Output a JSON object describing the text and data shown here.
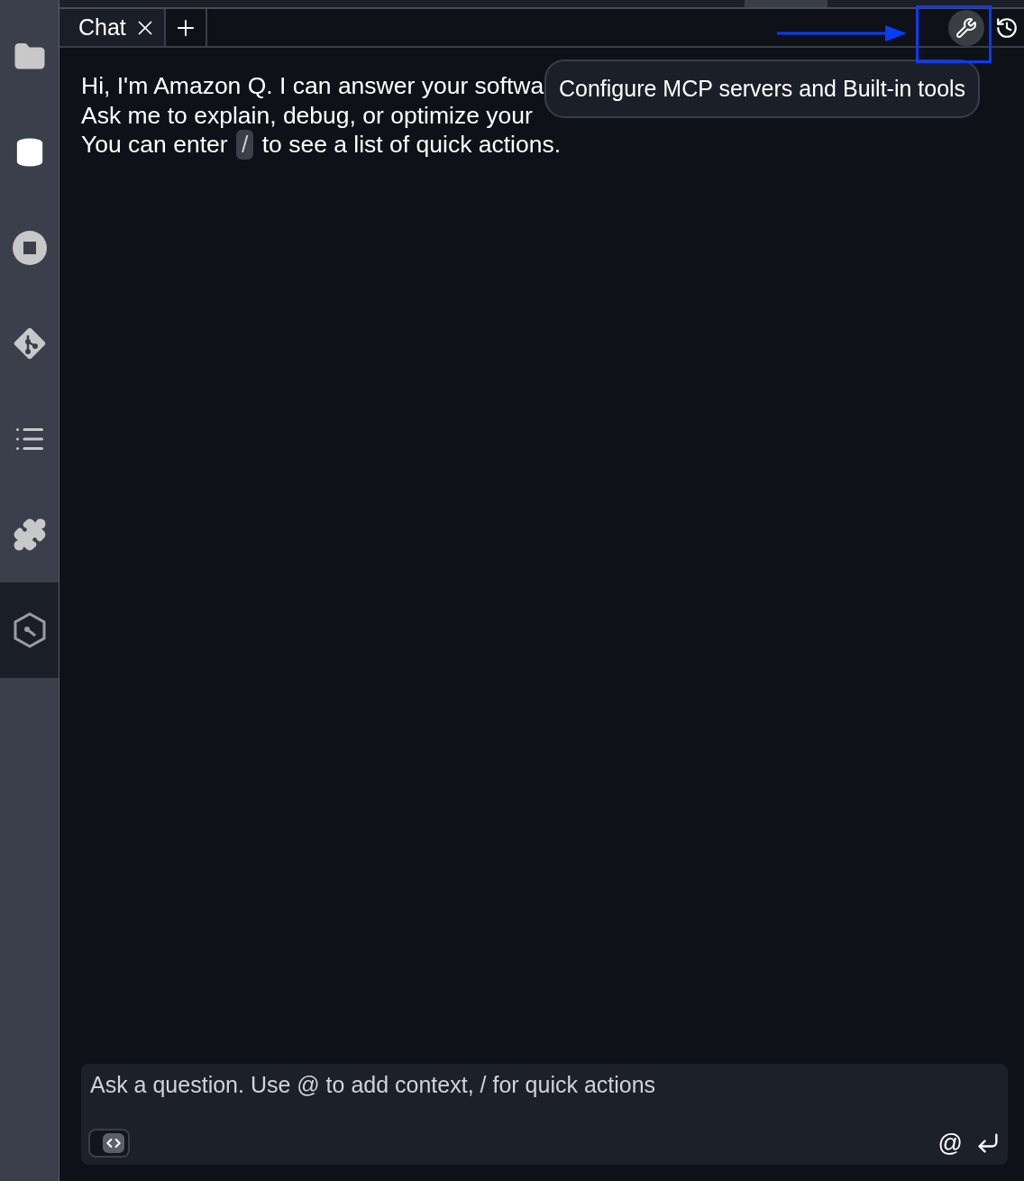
{
  "sidebar": {
    "items": [
      {
        "kind": "folder",
        "selected": false
      },
      {
        "kind": "database",
        "selected": false
      },
      {
        "kind": "stop",
        "selected": false
      },
      {
        "kind": "git",
        "selected": false
      },
      {
        "kind": "list",
        "selected": false
      },
      {
        "kind": "puzzle",
        "selected": false
      },
      {
        "kind": "hexagon",
        "selected": true
      }
    ]
  },
  "tabs": [
    {
      "label": "Chat",
      "selected": true
    }
  ],
  "message": {
    "lines": [
      {
        "text": "Hi, I'm Amazon Q. I can answer your softwa"
      },
      {
        "text": "Ask me to explain, debug, or optimize your"
      },
      {
        "text": "You can enter ",
        "code": "/",
        "after": " to see a list of quick actions."
      }
    ]
  },
  "tooltip": {
    "text": "Configure MCP servers and Built-in tools"
  },
  "input": {
    "placeholder": "Ask a question. Use @ to add context, / for quick actions",
    "mention": "@"
  }
}
